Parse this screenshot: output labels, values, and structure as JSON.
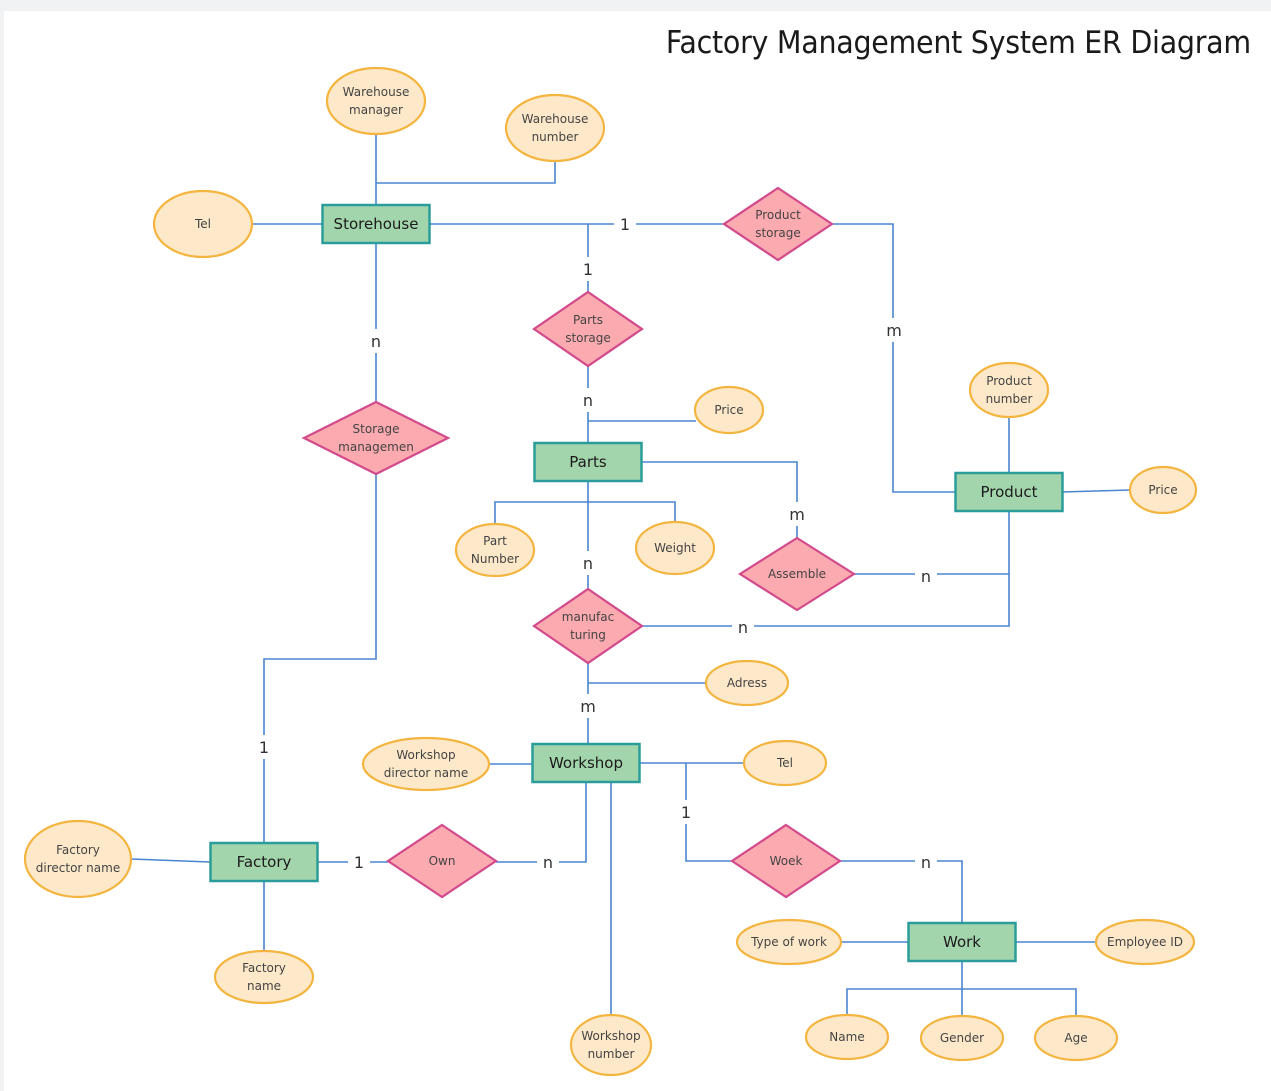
{
  "title": "Factory Management System ER Diagram",
  "colors": {
    "entity_fill": "#a3d5ac",
    "entity_border": "#2a9d9a",
    "attribute_fill": "#fde9c9",
    "attribute_border": "#f3b53f",
    "relationship_fill": "#fbaaaf",
    "relationship_border": "#d24a8c",
    "connector": "#4a86d0"
  },
  "entities": [
    {
      "id": "storehouse",
      "label": "Storehouse"
    },
    {
      "id": "parts",
      "label": "Parts"
    },
    {
      "id": "product",
      "label": "Product"
    },
    {
      "id": "workshop",
      "label": "Workshop"
    },
    {
      "id": "factory",
      "label": "Factory"
    },
    {
      "id": "work",
      "label": "Work"
    }
  ],
  "attributes": [
    {
      "id": "wh-manager",
      "entity": "storehouse",
      "lines": [
        "Warehouse",
        "manager"
      ]
    },
    {
      "id": "wh-number",
      "entity": "storehouse",
      "lines": [
        "Warehouse",
        "number"
      ]
    },
    {
      "id": "storehouse-tel",
      "entity": "storehouse",
      "lines": [
        "Tel"
      ]
    },
    {
      "id": "parts-price",
      "entity": "parts",
      "lines": [
        "Price"
      ]
    },
    {
      "id": "part-number",
      "entity": "parts",
      "lines": [
        "Part",
        "Number"
      ]
    },
    {
      "id": "weight",
      "entity": "parts",
      "lines": [
        "Weight"
      ]
    },
    {
      "id": "product-number",
      "entity": "product",
      "lines": [
        "Product",
        "number"
      ]
    },
    {
      "id": "product-price",
      "entity": "product",
      "lines": [
        "Price"
      ]
    },
    {
      "id": "adress",
      "entity": "workshop",
      "lines": [
        "Adress"
      ]
    },
    {
      "id": "workshop-director",
      "entity": "workshop",
      "lines": [
        "Workshop",
        "director name"
      ]
    },
    {
      "id": "workshop-tel",
      "entity": "workshop",
      "lines": [
        "Tel"
      ]
    },
    {
      "id": "workshop-number",
      "entity": "workshop",
      "lines": [
        "Workshop",
        "number"
      ]
    },
    {
      "id": "factory-director",
      "entity": "factory",
      "lines": [
        "Factory",
        "director name"
      ]
    },
    {
      "id": "factory-name",
      "entity": "factory",
      "lines": [
        "Factory",
        "name"
      ]
    },
    {
      "id": "type-of-work",
      "entity": "work",
      "lines": [
        "Type of work"
      ]
    },
    {
      "id": "employee-id",
      "entity": "work",
      "lines": [
        "Employee ID"
      ]
    },
    {
      "id": "name",
      "entity": "work",
      "lines": [
        "Name"
      ]
    },
    {
      "id": "gender",
      "entity": "work",
      "lines": [
        "Gender"
      ]
    },
    {
      "id": "age",
      "entity": "work",
      "lines": [
        "Age"
      ]
    }
  ],
  "relationships": [
    {
      "id": "product-storage",
      "lines": [
        "Product",
        "storage"
      ],
      "between": [
        "storehouse",
        "product"
      ],
      "cardinality": [
        "1",
        "m"
      ]
    },
    {
      "id": "parts-storage",
      "lines": [
        "Parts",
        "storage"
      ],
      "between": [
        "storehouse",
        "parts"
      ],
      "cardinality": [
        "1",
        "n"
      ]
    },
    {
      "id": "storage-management",
      "lines": [
        "Storage",
        "managemen"
      ],
      "between": [
        "storehouse",
        "factory"
      ],
      "cardinality": [
        "n",
        "1"
      ]
    },
    {
      "id": "assemble",
      "lines": [
        "Assemble"
      ],
      "between": [
        "parts",
        "product"
      ],
      "cardinality": [
        "m",
        "n"
      ]
    },
    {
      "id": "manufacturing",
      "lines": [
        "manufac",
        "turing"
      ],
      "between": [
        "parts",
        "workshop",
        "product"
      ],
      "cardinality": [
        "n",
        "m",
        "n"
      ]
    },
    {
      "id": "own",
      "lines": [
        "Own"
      ],
      "between": [
        "factory",
        "workshop"
      ],
      "cardinality": [
        "1",
        "n"
      ]
    },
    {
      "id": "woek",
      "lines": [
        "Woek"
      ],
      "between": [
        "workshop",
        "work"
      ],
      "cardinality": [
        "1",
        "n"
      ]
    }
  ]
}
